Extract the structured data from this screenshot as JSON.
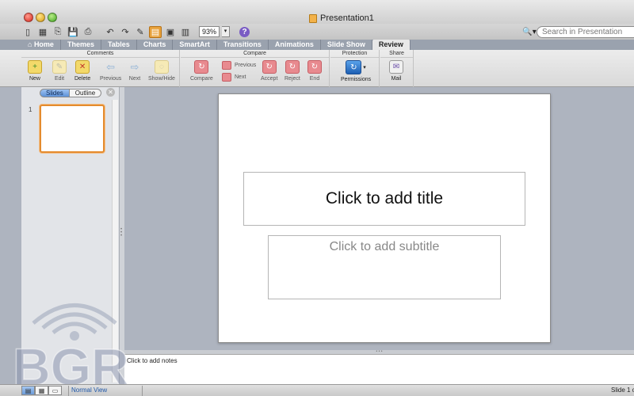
{
  "window": {
    "title": "Presentation1"
  },
  "toolbar": {
    "zoom_value": "93%",
    "search": {
      "placeholder": "Search in Presentation",
      "value": ""
    }
  },
  "ribbon": {
    "tabs": [
      {
        "label": "Home"
      },
      {
        "label": "Themes"
      },
      {
        "label": "Tables"
      },
      {
        "label": "Charts"
      },
      {
        "label": "SmartArt"
      },
      {
        "label": "Transitions"
      },
      {
        "label": "Animations"
      },
      {
        "label": "Slide Show"
      },
      {
        "label": "Review",
        "active": true
      }
    ],
    "groups": {
      "comments": {
        "title": "Comments",
        "buttons": [
          "New",
          "Edit",
          "Delete",
          "Previous",
          "Next",
          "Show/Hide"
        ]
      },
      "compare": {
        "title": "Compare",
        "buttons": [
          "Compare",
          "Previous",
          "Next",
          "Accept",
          "Reject",
          "End"
        ]
      },
      "protection": {
        "title": "Protection",
        "buttons": [
          "Permissions"
        ]
      },
      "share": {
        "title": "Share",
        "buttons": [
          "Mail"
        ]
      }
    }
  },
  "left_pane": {
    "tabs": [
      "Slides",
      "Outline"
    ],
    "active_tab": "Slides",
    "slide_numbers": [
      "1"
    ]
  },
  "slide": {
    "title_placeholder": "Click to add title",
    "subtitle_placeholder": "Click to add subtitle"
  },
  "notes": {
    "placeholder": "Click to add notes"
  },
  "status": {
    "view_label": "Normal View",
    "slide_count": "Slide 1 o"
  },
  "watermark": {
    "text": "BGR"
  },
  "colors": {
    "accent_orange": "#e48b2e",
    "canvas_bg": "#aeb4bf",
    "active_blue": "#5d92d8"
  }
}
